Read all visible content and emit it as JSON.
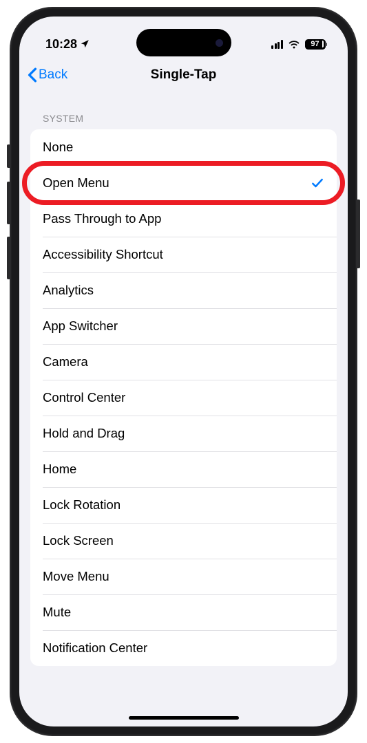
{
  "status": {
    "time": "10:28",
    "battery": "97"
  },
  "nav": {
    "back": "Back",
    "title": "Single-Tap"
  },
  "section": {
    "header": "SYSTEM"
  },
  "items": [
    {
      "label": "None",
      "selected": false,
      "highlighted": false
    },
    {
      "label": "Open Menu",
      "selected": true,
      "highlighted": true
    },
    {
      "label": "Pass Through to App",
      "selected": false,
      "highlighted": false
    },
    {
      "label": "Accessibility Shortcut",
      "selected": false,
      "highlighted": false
    },
    {
      "label": "Analytics",
      "selected": false,
      "highlighted": false
    },
    {
      "label": "App Switcher",
      "selected": false,
      "highlighted": false
    },
    {
      "label": "Camera",
      "selected": false,
      "highlighted": false
    },
    {
      "label": "Control Center",
      "selected": false,
      "highlighted": false
    },
    {
      "label": "Hold and Drag",
      "selected": false,
      "highlighted": false
    },
    {
      "label": "Home",
      "selected": false,
      "highlighted": false
    },
    {
      "label": "Lock Rotation",
      "selected": false,
      "highlighted": false
    },
    {
      "label": "Lock Screen",
      "selected": false,
      "highlighted": false
    },
    {
      "label": "Move Menu",
      "selected": false,
      "highlighted": false
    },
    {
      "label": "Mute",
      "selected": false,
      "highlighted": false
    },
    {
      "label": "Notification Center",
      "selected": false,
      "highlighted": false
    }
  ]
}
